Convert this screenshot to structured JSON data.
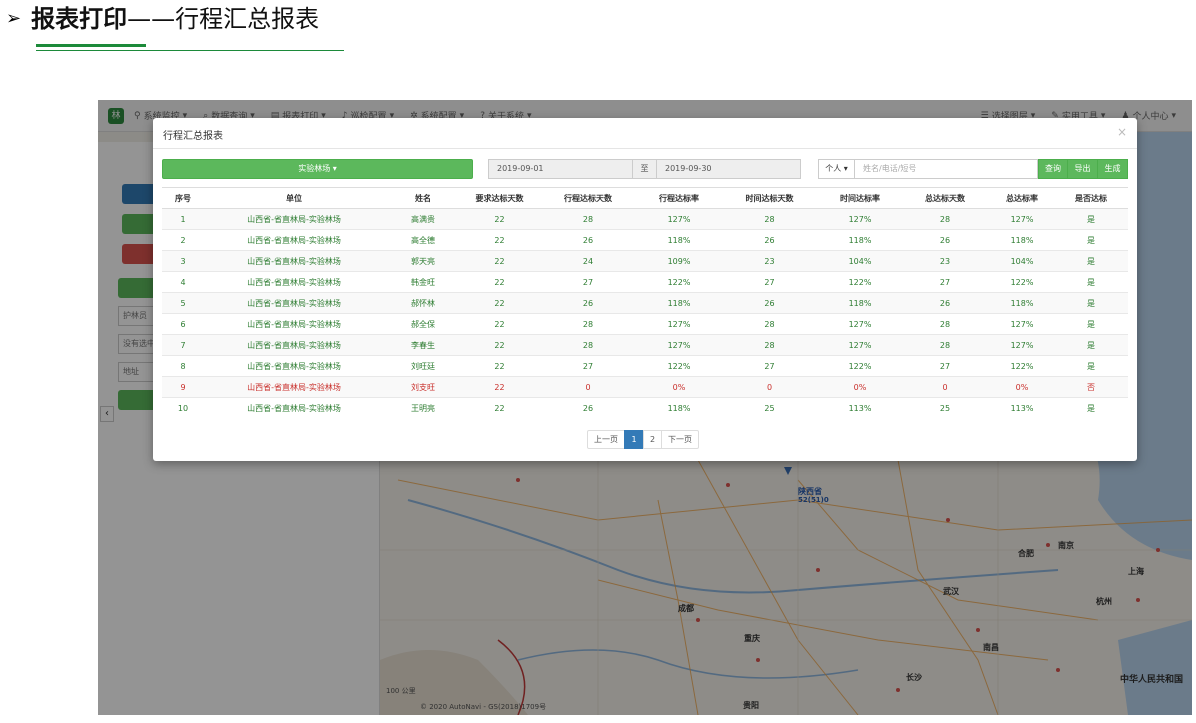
{
  "slide": {
    "bullet": "➢",
    "title_bold": "报表打印",
    "title_rest": "——行程汇总报表"
  },
  "navbar": {
    "items": [
      "系统监控",
      "数据查询",
      "报表打印",
      "巡检配置",
      "系统配置",
      "关于系统"
    ],
    "right_items": [
      "选择图层",
      "实用工具",
      "个人中心"
    ]
  },
  "left_panel": {
    "field1": "护林员",
    "field2": "没有选中",
    "field3": "地址"
  },
  "map": {
    "labels": [
      "陕西省",
      "武汉",
      "合肥",
      "南京",
      "上海",
      "杭州",
      "成都",
      "重庆",
      "长沙",
      "南昌",
      "贵阳",
      "中华人民共和国",
      "100 公里",
      "© 2020 AutoNavi - GS(2018)1709号"
    ],
    "marker": "52(51)0"
  },
  "modal": {
    "title": "行程汇总报表",
    "close": "×",
    "unit_select": "实验林场 ▾",
    "date_start": "2019-09-01",
    "date_sep": "至",
    "date_end": "2019-09-30",
    "type_select": "个人 ▾",
    "search_placeholder": "姓名/电话/短号",
    "btn_query": "查询",
    "btn_export": "导出",
    "btn_generate": "生成"
  },
  "table": {
    "headers": [
      "序号",
      "单位",
      "姓名",
      "要求达标天数",
      "行程达标天数",
      "行程达标率",
      "时间达标天数",
      "时间达标率",
      "总达标天数",
      "总达标率",
      "是否达标"
    ],
    "rows": [
      [
        "1",
        "山西省-省直林局-实验林场",
        "高满贵",
        "22",
        "28",
        "127%",
        "28",
        "127%",
        "28",
        "127%",
        "是"
      ],
      [
        "2",
        "山西省-省直林局-实验林场",
        "高全德",
        "22",
        "26",
        "118%",
        "26",
        "118%",
        "26",
        "118%",
        "是"
      ],
      [
        "3",
        "山西省-省直林局-实验林场",
        "郭天亮",
        "22",
        "24",
        "109%",
        "23",
        "104%",
        "23",
        "104%",
        "是"
      ],
      [
        "4",
        "山西省-省直林局-实验林场",
        "韩金旺",
        "22",
        "27",
        "122%",
        "27",
        "122%",
        "27",
        "122%",
        "是"
      ],
      [
        "5",
        "山西省-省直林局-实验林场",
        "郝怀林",
        "22",
        "26",
        "118%",
        "26",
        "118%",
        "26",
        "118%",
        "是"
      ],
      [
        "6",
        "山西省-省直林局-实验林场",
        "郝全保",
        "22",
        "28",
        "127%",
        "28",
        "127%",
        "28",
        "127%",
        "是"
      ],
      [
        "7",
        "山西省-省直林局-实验林场",
        "李春生",
        "22",
        "28",
        "127%",
        "28",
        "127%",
        "28",
        "127%",
        "是"
      ],
      [
        "8",
        "山西省-省直林局-实验林场",
        "刘旺廷",
        "22",
        "27",
        "122%",
        "27",
        "122%",
        "27",
        "122%",
        "是"
      ],
      [
        "9",
        "山西省-省直林局-实验林场",
        "刘支旺",
        "22",
        "0",
        "0%",
        "0",
        "0%",
        "0",
        "0%",
        "否"
      ],
      [
        "10",
        "山西省-省直林局-实验林场",
        "王明亮",
        "22",
        "26",
        "118%",
        "25",
        "113%",
        "25",
        "113%",
        "是"
      ]
    ]
  },
  "pagination": {
    "prev": "上一页",
    "page1": "1",
    "page2": "2",
    "next": "下一页"
  },
  "colors": {
    "green": "#5cb85c",
    "pass_text": "#2e7d32",
    "fail_text": "#c9302c",
    "active_page": "#337ab7"
  }
}
